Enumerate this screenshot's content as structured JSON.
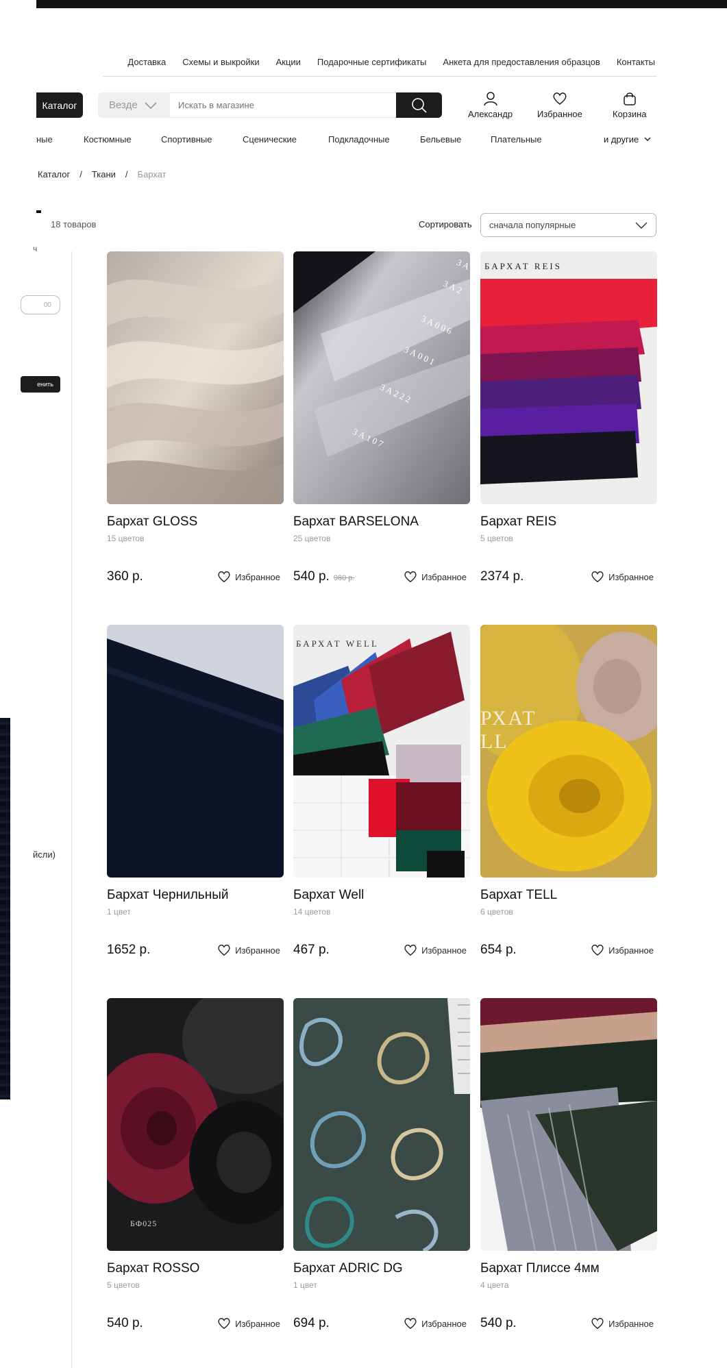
{
  "header": {
    "top_links": [
      "Доставка",
      "Схемы и выкройки",
      "Акции",
      "Подарочные сертификаты",
      "Анкета для предоставления образцов",
      "Контакты"
    ],
    "catalog_label": "Каталог",
    "search_scope": "Везде",
    "search_placeholder": "Искать в магазине",
    "user_label": "Александр",
    "favorites_label": "Избранное",
    "cart_label": "Корзина"
  },
  "categories": {
    "items": [
      "ные",
      "Костюмные",
      "Спортивные",
      "Сценические",
      "Подкладочные",
      "Бельевые",
      "Плательные"
    ],
    "more_label": "и другие"
  },
  "breadcrumbs": [
    "Каталог",
    "Ткани",
    "Бархат"
  ],
  "listing": {
    "count": "18 товаров",
    "sort_label": "Сортировать",
    "sort_value": "сначала популярные"
  },
  "sidebar": {
    "frag_top": "ч",
    "input_value": "00",
    "apply_label": "енить",
    "frag_bottom": "йсли)"
  },
  "products": [
    {
      "title": "Бархат GLOSS",
      "colors": "15 цветов",
      "price": "360 р.",
      "old_price": "",
      "fav": "Избранное"
    },
    {
      "title": "Бархат BARSELONA",
      "colors": "25 цветов",
      "price": "540 р.",
      "old_price": "980 р.",
      "fav": "Избранное"
    },
    {
      "title": "Бархат REIS",
      "colors": "5 цветов",
      "price": "2374 р.",
      "old_price": "",
      "fav": "Избранное"
    },
    {
      "title": "Бархат Чернильный",
      "colors": "1 цвет",
      "price": "1652 р.",
      "old_price": "",
      "fav": "Избранное"
    },
    {
      "title": "Бархат Well",
      "colors": "14 цветов",
      "price": "467 р.",
      "old_price": "",
      "fav": "Избранное"
    },
    {
      "title": "Бархат TELL",
      "colors": "6 цветов",
      "price": "654 р.",
      "old_price": "",
      "fav": "Избранное"
    },
    {
      "title": "Бархат ROSSO",
      "colors": "5 цветов",
      "price": "540 р.",
      "old_price": "",
      "fav": "Избранное"
    },
    {
      "title": "Бархат ADRIC DG",
      "colors": "1 цвет",
      "price": "694 р.",
      "old_price": "",
      "fav": "Избранное"
    },
    {
      "title": "Бархат Плиссе 4мм",
      "colors": "4 цвета",
      "price": "540 р.",
      "old_price": "",
      "fav": "Избранное"
    }
  ],
  "image_labels": {
    "barselona_codes": [
      "3A",
      "3A2",
      "3A006",
      "3A001",
      "3A222",
      "3A107"
    ],
    "reis": "БАРХАТ REIS",
    "well": "БАРХАТ WELL",
    "tell": "РХАТ LL",
    "rosso": "БФ025"
  }
}
